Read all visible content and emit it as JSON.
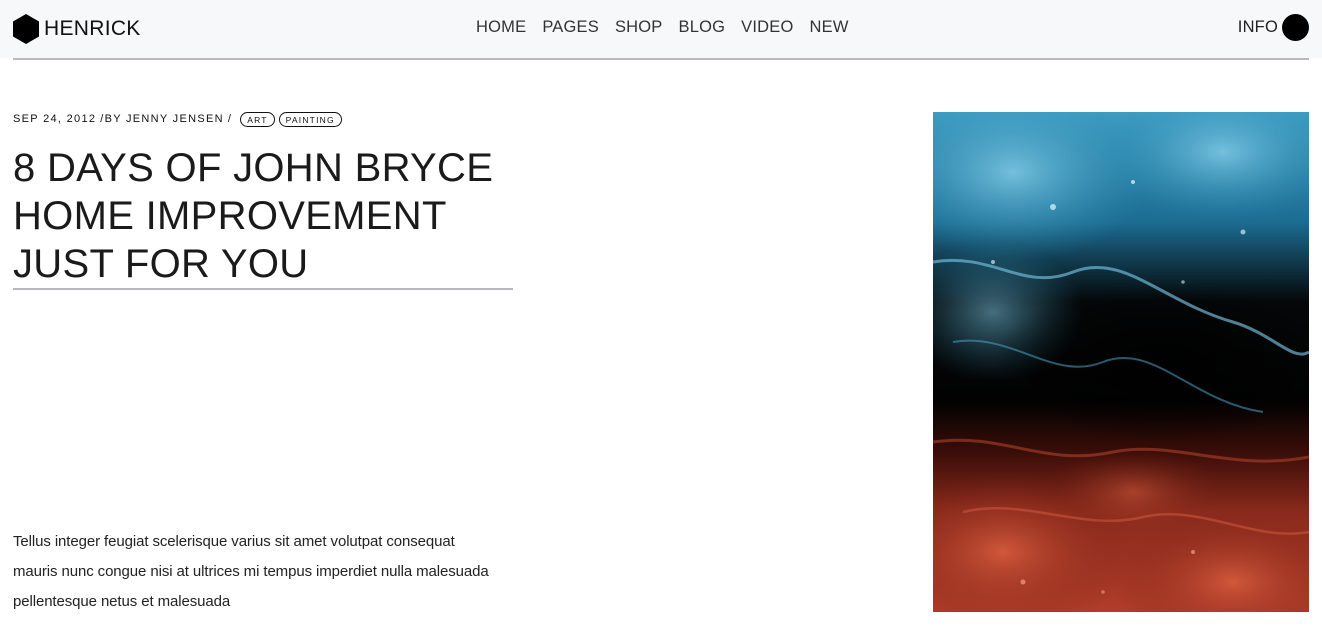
{
  "brand": {
    "name": "HENRICK",
    "icon": "hexagon-logo-icon"
  },
  "nav": {
    "items": [
      "HOME",
      "PAGES",
      "SHOP",
      "BLOG",
      "VIDEO",
      "NEW"
    ]
  },
  "header_right": {
    "label": "INFO",
    "icon": "black-circle-icon"
  },
  "post": {
    "date": "SEP 24, 2012",
    "by": "/BY",
    "author": "JENNY JENSEN",
    "sep": "/",
    "tags": [
      "ART",
      "PAINTING"
    ],
    "title": "8 DAYS OF JOHN BRYCE HOME IMPROVEMENT JUST FOR YOU",
    "excerpt": "Tellus integer feugiat scelerisque varius sit amet volutpat consequat mauris nunc congue nisi at ultrices mi tempus imperdiet nulla malesuada pellentesque netus et malesuada"
  },
  "feature_image": {
    "subject": "abstract-fluid-paint-blue-black-red"
  },
  "colors": {
    "header_bg": "#f7f8fa",
    "text": "#111111",
    "rule": "#b9b9bd",
    "paint_blue": "#2a8fb4",
    "paint_red": "#b43a28"
  }
}
